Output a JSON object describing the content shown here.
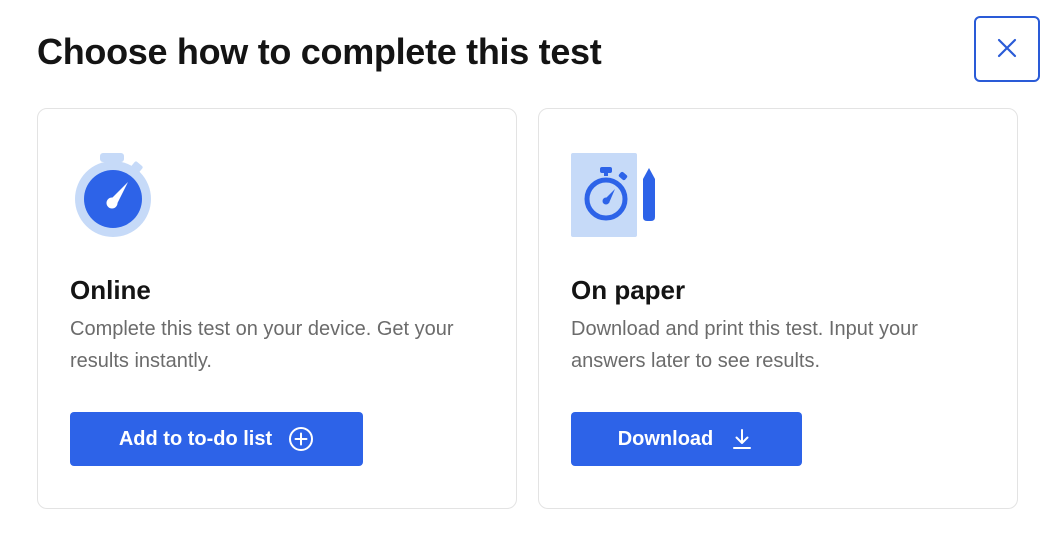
{
  "dialog": {
    "title": "Choose how to complete this test",
    "close_icon": "close-icon"
  },
  "options": [
    {
      "icon": "stopwatch-icon",
      "title": "Online",
      "description": "Complete this test on your device. Get your results instantly.",
      "button_label": "Add to to-do list",
      "button_icon": "plus-circle-icon"
    },
    {
      "icon": "stopwatch-paper-pencil-icon",
      "title": "On paper",
      "description": "Download and print this test. Input your answers later to see results.",
      "button_label": "Download",
      "button_icon": "download-icon"
    }
  ],
  "colors": {
    "accent": "#2d63e8",
    "accent_light": "#c6daf8",
    "close_border": "#2a5bd7",
    "title": "#141414",
    "description": "#6b6b6b",
    "card_border": "#e3e3e3"
  }
}
